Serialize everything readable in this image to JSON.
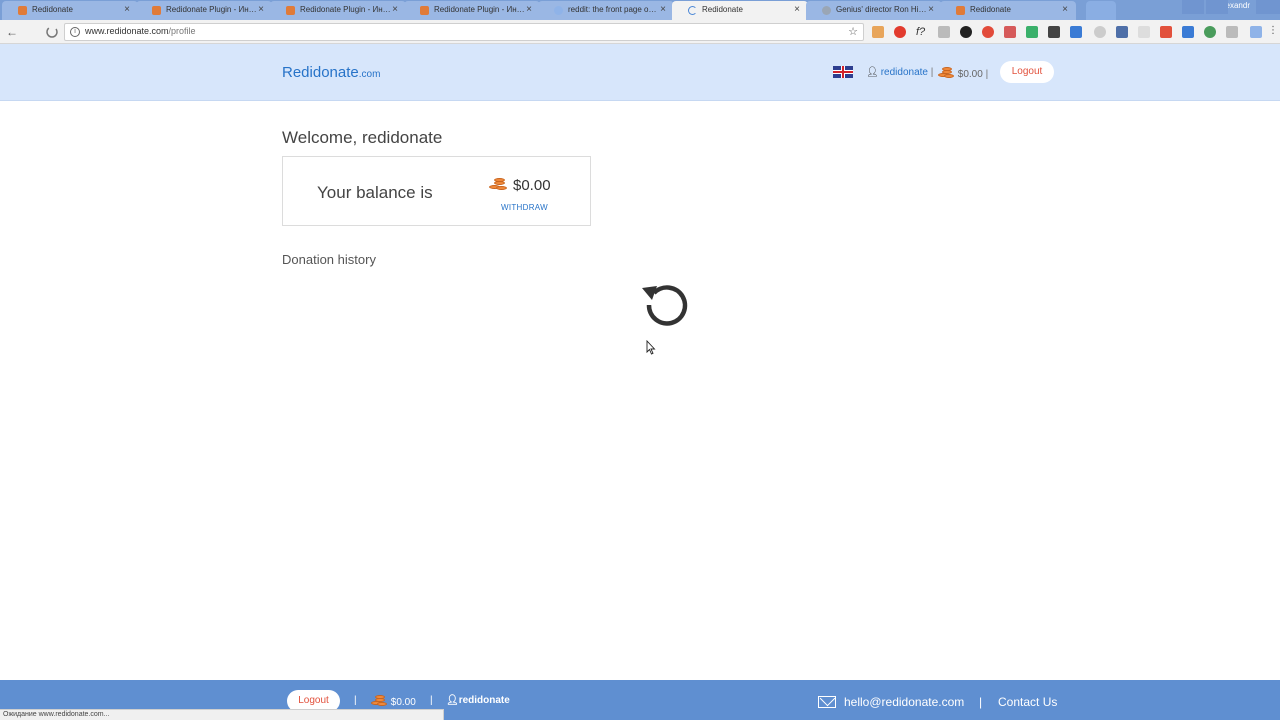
{
  "browser": {
    "tabs": [
      {
        "title": "Redidonate",
        "active": false
      },
      {
        "title": "Redidonate Plugin - Ин…",
        "active": false
      },
      {
        "title": "Redidonate Plugin - Ин…",
        "active": false
      },
      {
        "title": "Redidonate Plugin - Ин…",
        "active": false
      },
      {
        "title": "reddit: the front page o…",
        "active": false
      },
      {
        "title": "Redidonate",
        "active": true
      },
      {
        "title": "Genius' director Ron Hi…",
        "active": false
      },
      {
        "title": "Redidonate",
        "active": false
      }
    ],
    "close_glyph": "×",
    "window_user": "Alexandr",
    "url_host": "www.redidonate.com",
    "url_path": "/profile",
    "status_text": "Ожидание www.redidonate.com..."
  },
  "header": {
    "brand": "Redidonate",
    "brand_tld": ".com",
    "language_flag": "uk-flag",
    "username": "redidonate",
    "separator": "|",
    "balance": "$0.00",
    "logout_label": "Logout"
  },
  "main": {
    "welcome": "Welcome, redidonate",
    "balance_label": "Your balance is",
    "balance_amount": "$0.00",
    "withdraw_label": "WITHDRAW",
    "history_title": "Donation history",
    "loading": true
  },
  "footer": {
    "logout_label": "Logout",
    "separator": "|",
    "balance": "$0.00",
    "username": "redidonate",
    "email": "hello@redidonate.com",
    "contact_label": "Contact Us"
  },
  "colors": {
    "brand_blue": "#2773c8",
    "header_bg": "#d7e6fb",
    "footer_bg": "#5f8fd1",
    "logout_red": "#e2513c",
    "coin_orange": "#f08a3c"
  }
}
